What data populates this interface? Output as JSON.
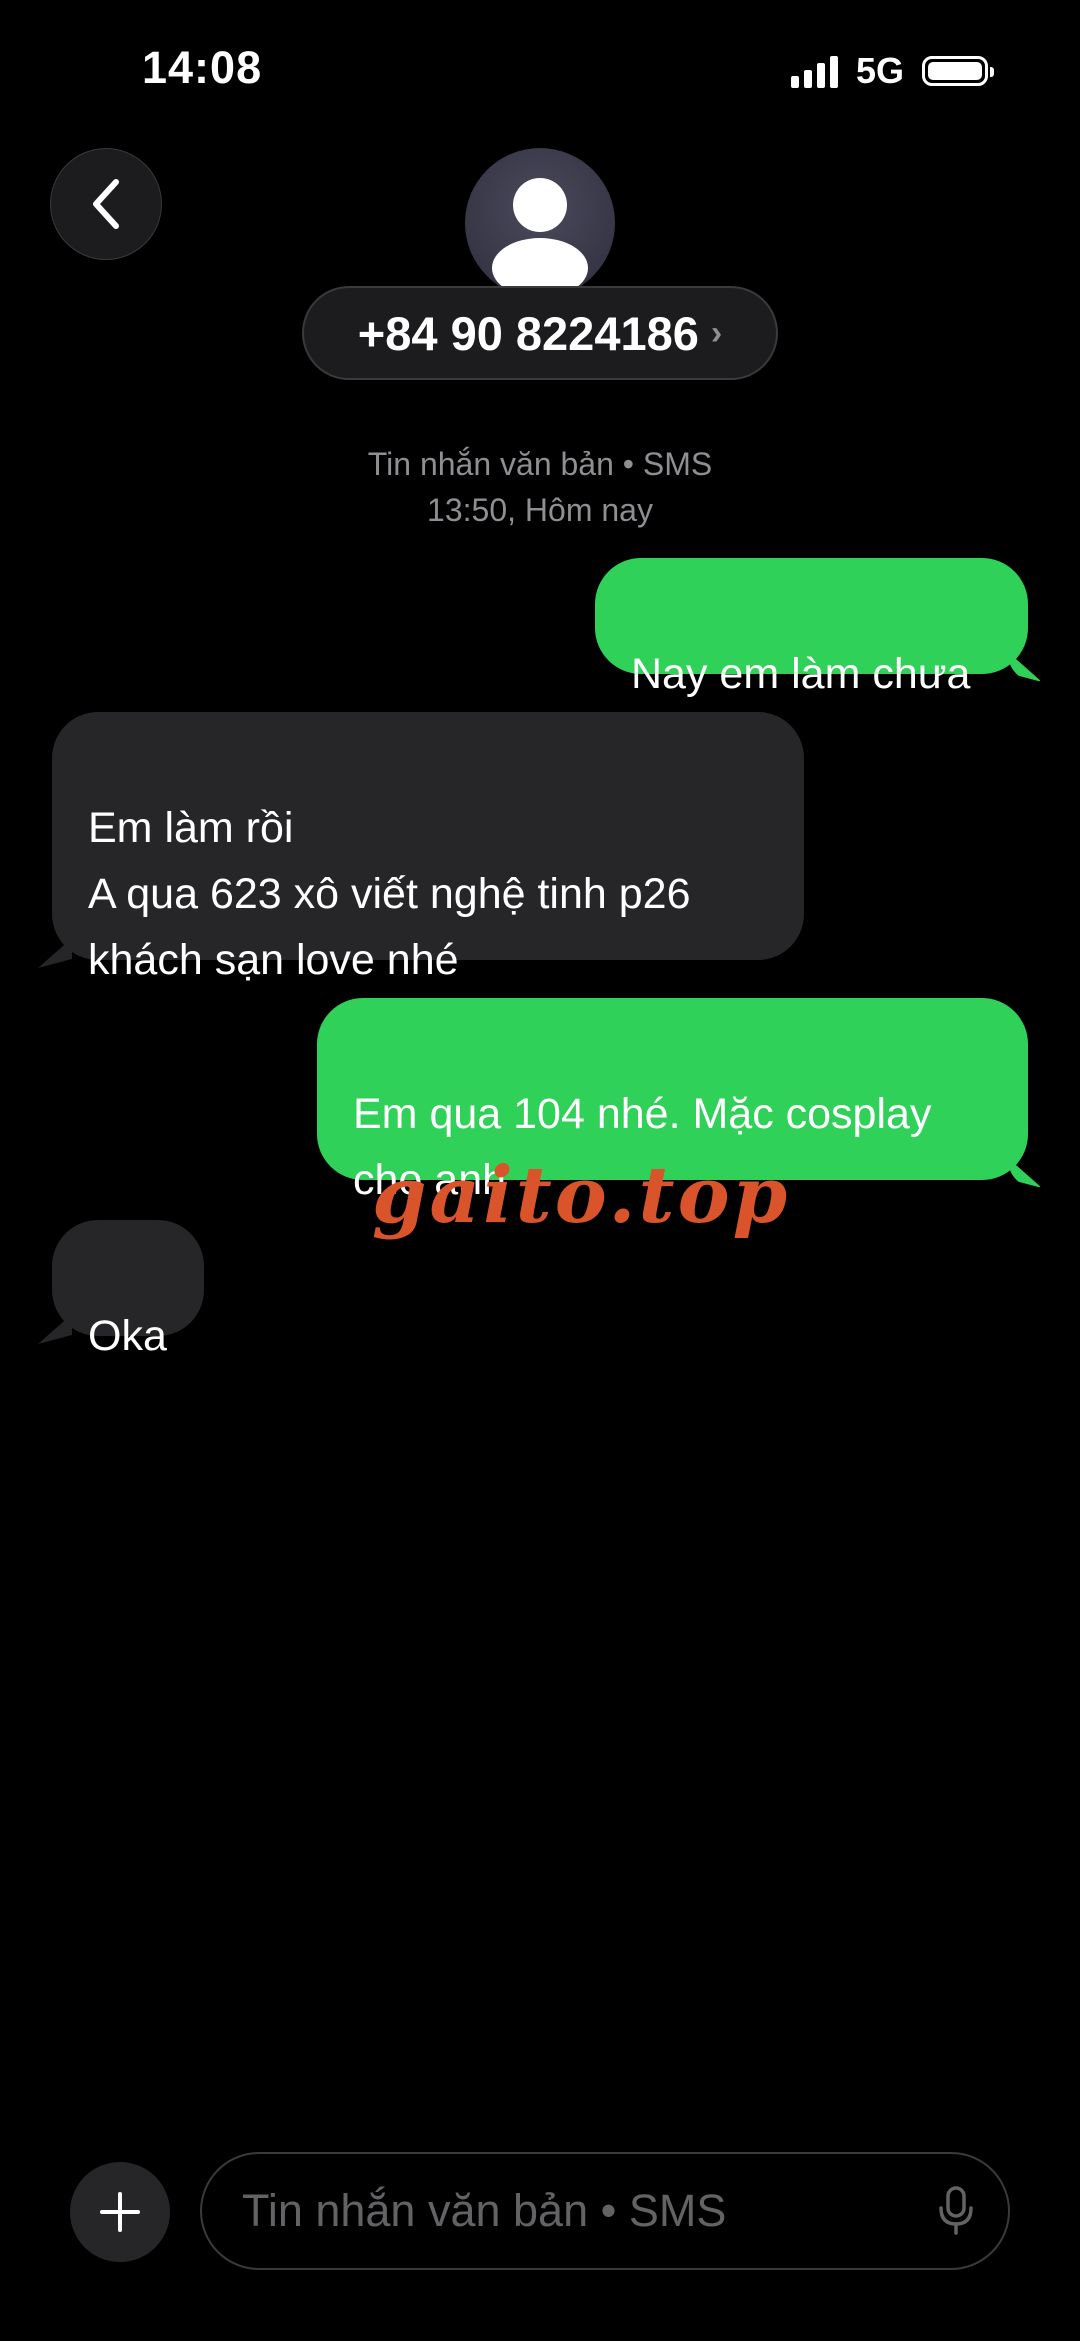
{
  "status_bar": {
    "time": "14:08",
    "network": "5G"
  },
  "header": {
    "back_icon": "chevron-left-icon",
    "avatar_icon": "person-silhouette-icon",
    "contact_number": "+84 90 8224186",
    "contact_chevron": "›"
  },
  "conversation": {
    "meta_line1": "Tin nhắn văn bản • SMS",
    "meta_line2": "13:50, Hôm nay",
    "messages": [
      {
        "direction": "outgoing",
        "text": "Nay em làm chưa"
      },
      {
        "direction": "incoming",
        "text": "Em làm rồi\nA qua 623 xô viết nghệ tinh p26\nkhách sạn love nhé"
      },
      {
        "direction": "outgoing",
        "text": "Em qua 104 nhé. Mặc cosplay\ncho anh"
      },
      {
        "direction": "incoming",
        "text": "Oka"
      }
    ]
  },
  "watermark": "gaito.top",
  "composer": {
    "plus_icon": "plus-icon",
    "placeholder": "Tin nhắn văn bản • SMS",
    "value": "",
    "mic_icon": "microphone-icon"
  },
  "colors": {
    "outgoing_bubble": "#30d158",
    "incoming_bubble": "#262629",
    "background": "#000000",
    "secondary_text": "#8e8e93",
    "watermark": "#d9542b"
  }
}
